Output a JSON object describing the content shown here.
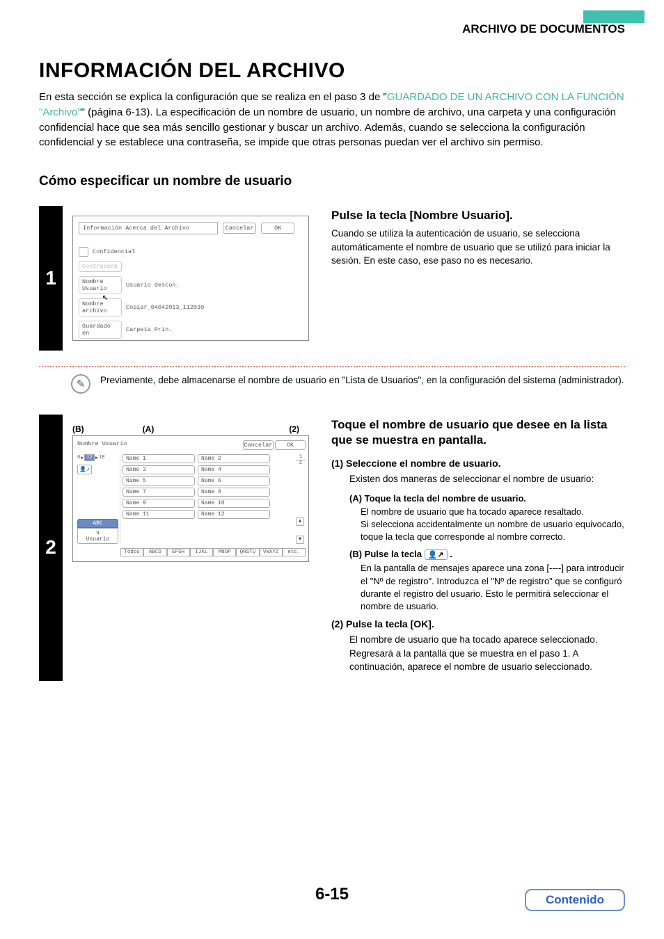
{
  "header": {
    "section": "ARCHIVO DE DOCUMENTOS"
  },
  "title": "INFORMACIÓN DEL ARCHIVO",
  "intro": {
    "t1": "En esta sección se explica la configuración que se realiza en el paso 3 de \"",
    "link": "GUARDADO DE UN ARCHIVO CON LA FUNCIÓN \"Archivo\"",
    "t2": "\" (página 6-13). La especificación de un nombre de usuario, un nombre de archivo, una carpeta y una configuración confidencial hace que sea más sencillo gestionar y buscar un archivo. Además, cuando se selecciona la configuración confidencial y se establece una contraseña, se impide que otras personas puedan ver el archivo sin permiso."
  },
  "subheading": "Cómo especificar un nombre de usuario",
  "step1": {
    "num": "1",
    "fig": {
      "title": "Información Acerca del Archivo",
      "cancel": "Cancelar",
      "ok": "OK",
      "conf": "Confidencial",
      "pass": "Contraseña",
      "nulbl": "Nombre Usuario",
      "nuval": "Usuario descon.",
      "nalbl": "Nombre archivo",
      "naval": "Copiar_04042013_112030",
      "gelbl": "Guardado en",
      "geval": "Carpeta Prin."
    },
    "h": "Pulse la tecla [Nombre Usuario].",
    "p": "Cuando se utiliza la autenticación de usuario, se selecciona automáticamente el nombre de usuario que se utilizó para iniciar la sesión. En este caso, ese paso no es necesario."
  },
  "note": "Previamente, debe almacenarse el nombre de usuario en \"Lista de Usuarios\", en la configuración del sistema (administrador).",
  "step2": {
    "num": "2",
    "annot": {
      "b": "(B)",
      "a": "(A)",
      "n2": "(2)"
    },
    "fig": {
      "title": "Nombre Usuario",
      "cancel": "Cancelar",
      "ok": "OK",
      "range": {
        "l": "6",
        "m": "12",
        "r": "18"
      },
      "abc": "ABC",
      "user": "Usuario",
      "names": [
        "Name 1",
        "Name 2",
        "Name 3",
        "Name 4",
        "Name 5",
        "Name 6",
        "Name 7",
        "Name 8",
        "Name 9",
        "Name 10",
        "Name 11",
        "Name 12"
      ],
      "pg": {
        "t": "1",
        "b": "2"
      },
      "tabs": [
        "Todos",
        "ABCD",
        "EFGH",
        "IJKL",
        "MNOP",
        "QRSTU",
        "VWXYZ",
        "etc."
      ]
    },
    "h": "Toque el nombre de usuario que desee en la lista que se muestra en pantalla.",
    "p1": {
      "h": "(1)  Seleccione el nombre de usuario.",
      "b": "Existen dos maneras de seleccionar el nombre de usuario:"
    },
    "pa": {
      "h": "(A) Toque la tecla del nombre de usuario.",
      "b": "El nombre de usuario que ha tocado aparece resaltado.\nSi selecciona accidentalmente un nombre de usuario equivocado, toque la tecla que corresponde al nombre correcto."
    },
    "pb": {
      "h1": "(B) Pulse la tecla ",
      "icon": "👤↗",
      "h2": " .",
      "b": "En la pantalla de mensajes aparece una zona [----] para introducir el \"Nº de registro\". Introduzca el \"Nº de registro\" que se configuró durante el registro del usuario. Esto le permitirá seleccionar el nombre de usuario."
    },
    "p2": {
      "h": "(2)  Pulse la tecla [OK].",
      "b": "El nombre de usuario que ha tocado aparece seleccionado. Regresará a la pantalla que se muestra en el paso 1. A continuación, aparece el nombre de usuario seleccionado."
    }
  },
  "pagenum": "6-15",
  "contenido": "Contenido"
}
